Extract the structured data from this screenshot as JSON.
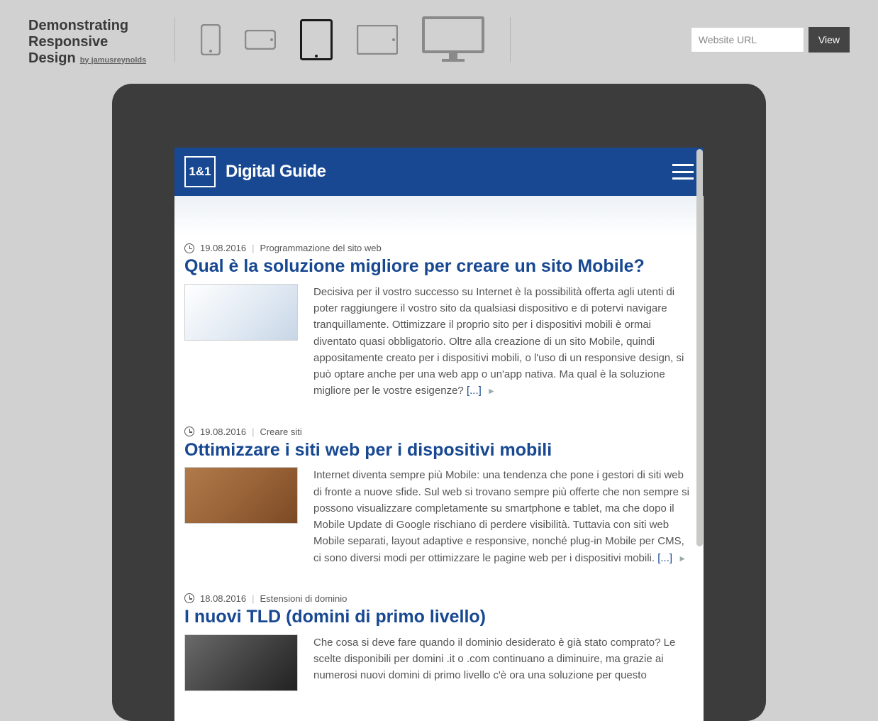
{
  "brand": {
    "title_line1": "Demonstrating",
    "title_line2": "Responsive",
    "title_line3": "Design",
    "author": "by jamusreynolds"
  },
  "controls": {
    "url_placeholder": "Website URL",
    "view_label": "View"
  },
  "page": {
    "logo_text": "1&1",
    "site_title": "Digital Guide"
  },
  "articles": [
    {
      "date": "19.08.2016",
      "category": "Programmazione del sito web",
      "title": "Qual è la soluzione migliore per creare un sito Mobile?",
      "excerpt": "Decisiva per il vostro successo su Internet è la possibilità offerta agli utenti di poter raggiungere il vostro sito da qualsiasi dispositivo e di potervi navigare tranquillamente. Ottimizzare il proprio sito per i dispositivi mobili è ormai diventato quasi obbligatorio. Oltre alla creazione di un sito Mobile, quindi appositamente creato per i dispositivi mobili, o l'uso di un responsive design, si può optare anche per una web app o un'app nativa. Ma qual è la soluzione migliore per le vostre esigenze?",
      "more": "[...]"
    },
    {
      "date": "19.08.2016",
      "category": "Creare siti",
      "title": "Ottimizzare i siti web per i dispositivi mobili",
      "excerpt": "Internet diventa sempre più Mobile: una tendenza che pone i gestori di siti web di fronte a nuove sfide. Sul web si trovano sempre più offerte che non sempre si possono visualizzare completamente su smartphone e tablet, ma che dopo il Mobile Update di Google rischiano di perdere visibilità. Tuttavia con siti web Mobile separati, layout adaptive e responsive, nonché plug-in Mobile per CMS, ci sono diversi modi per ottimizzare le pagine web per i dispositivi mobili.",
      "more": "[...]"
    },
    {
      "date": "18.08.2016",
      "category": "Estensioni di dominio",
      "title": "I nuovi TLD (domini di primo livello)",
      "excerpt": "Che cosa si deve fare quando il dominio desiderato è già stato comprato? Le scelte disponibili per domini .it o .com continuano a diminuire, ma grazie ai numerosi nuovi domini di primo livello c'è ora una soluzione per questo",
      "more": "[...]"
    }
  ]
}
